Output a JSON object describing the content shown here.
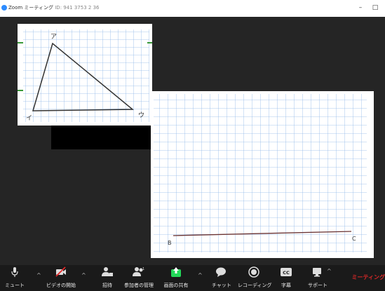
{
  "window": {
    "title": "Zoom ミーティング",
    "meeting_id_label": "ID: 9​41 3753 2 3​6",
    "minimize": "–",
    "maximize": "□"
  },
  "share_top": {
    "vertex_top": "ア",
    "vertex_left": "イ",
    "vertex_right": "ウ"
  },
  "share_main": {
    "label_b": "B",
    "label_c": "C"
  },
  "toolbar": {
    "mute_label": "ミュート",
    "video_label": "ビデオの開始",
    "invite_label": "招待",
    "participants_label": "参加者の管理",
    "participants_count": "1",
    "share_label": "画面の共有",
    "chat_label": "チャット",
    "record_label": "レコーディング",
    "cc_label": "字幕",
    "cc_icon_text": "CC",
    "support_label": "サポート",
    "end_label": "ミーティング",
    "caret": "^"
  },
  "colors": {
    "share_green": "#23d959",
    "end_red": "#e02828",
    "zoom_blue": "#2d8cff"
  }
}
